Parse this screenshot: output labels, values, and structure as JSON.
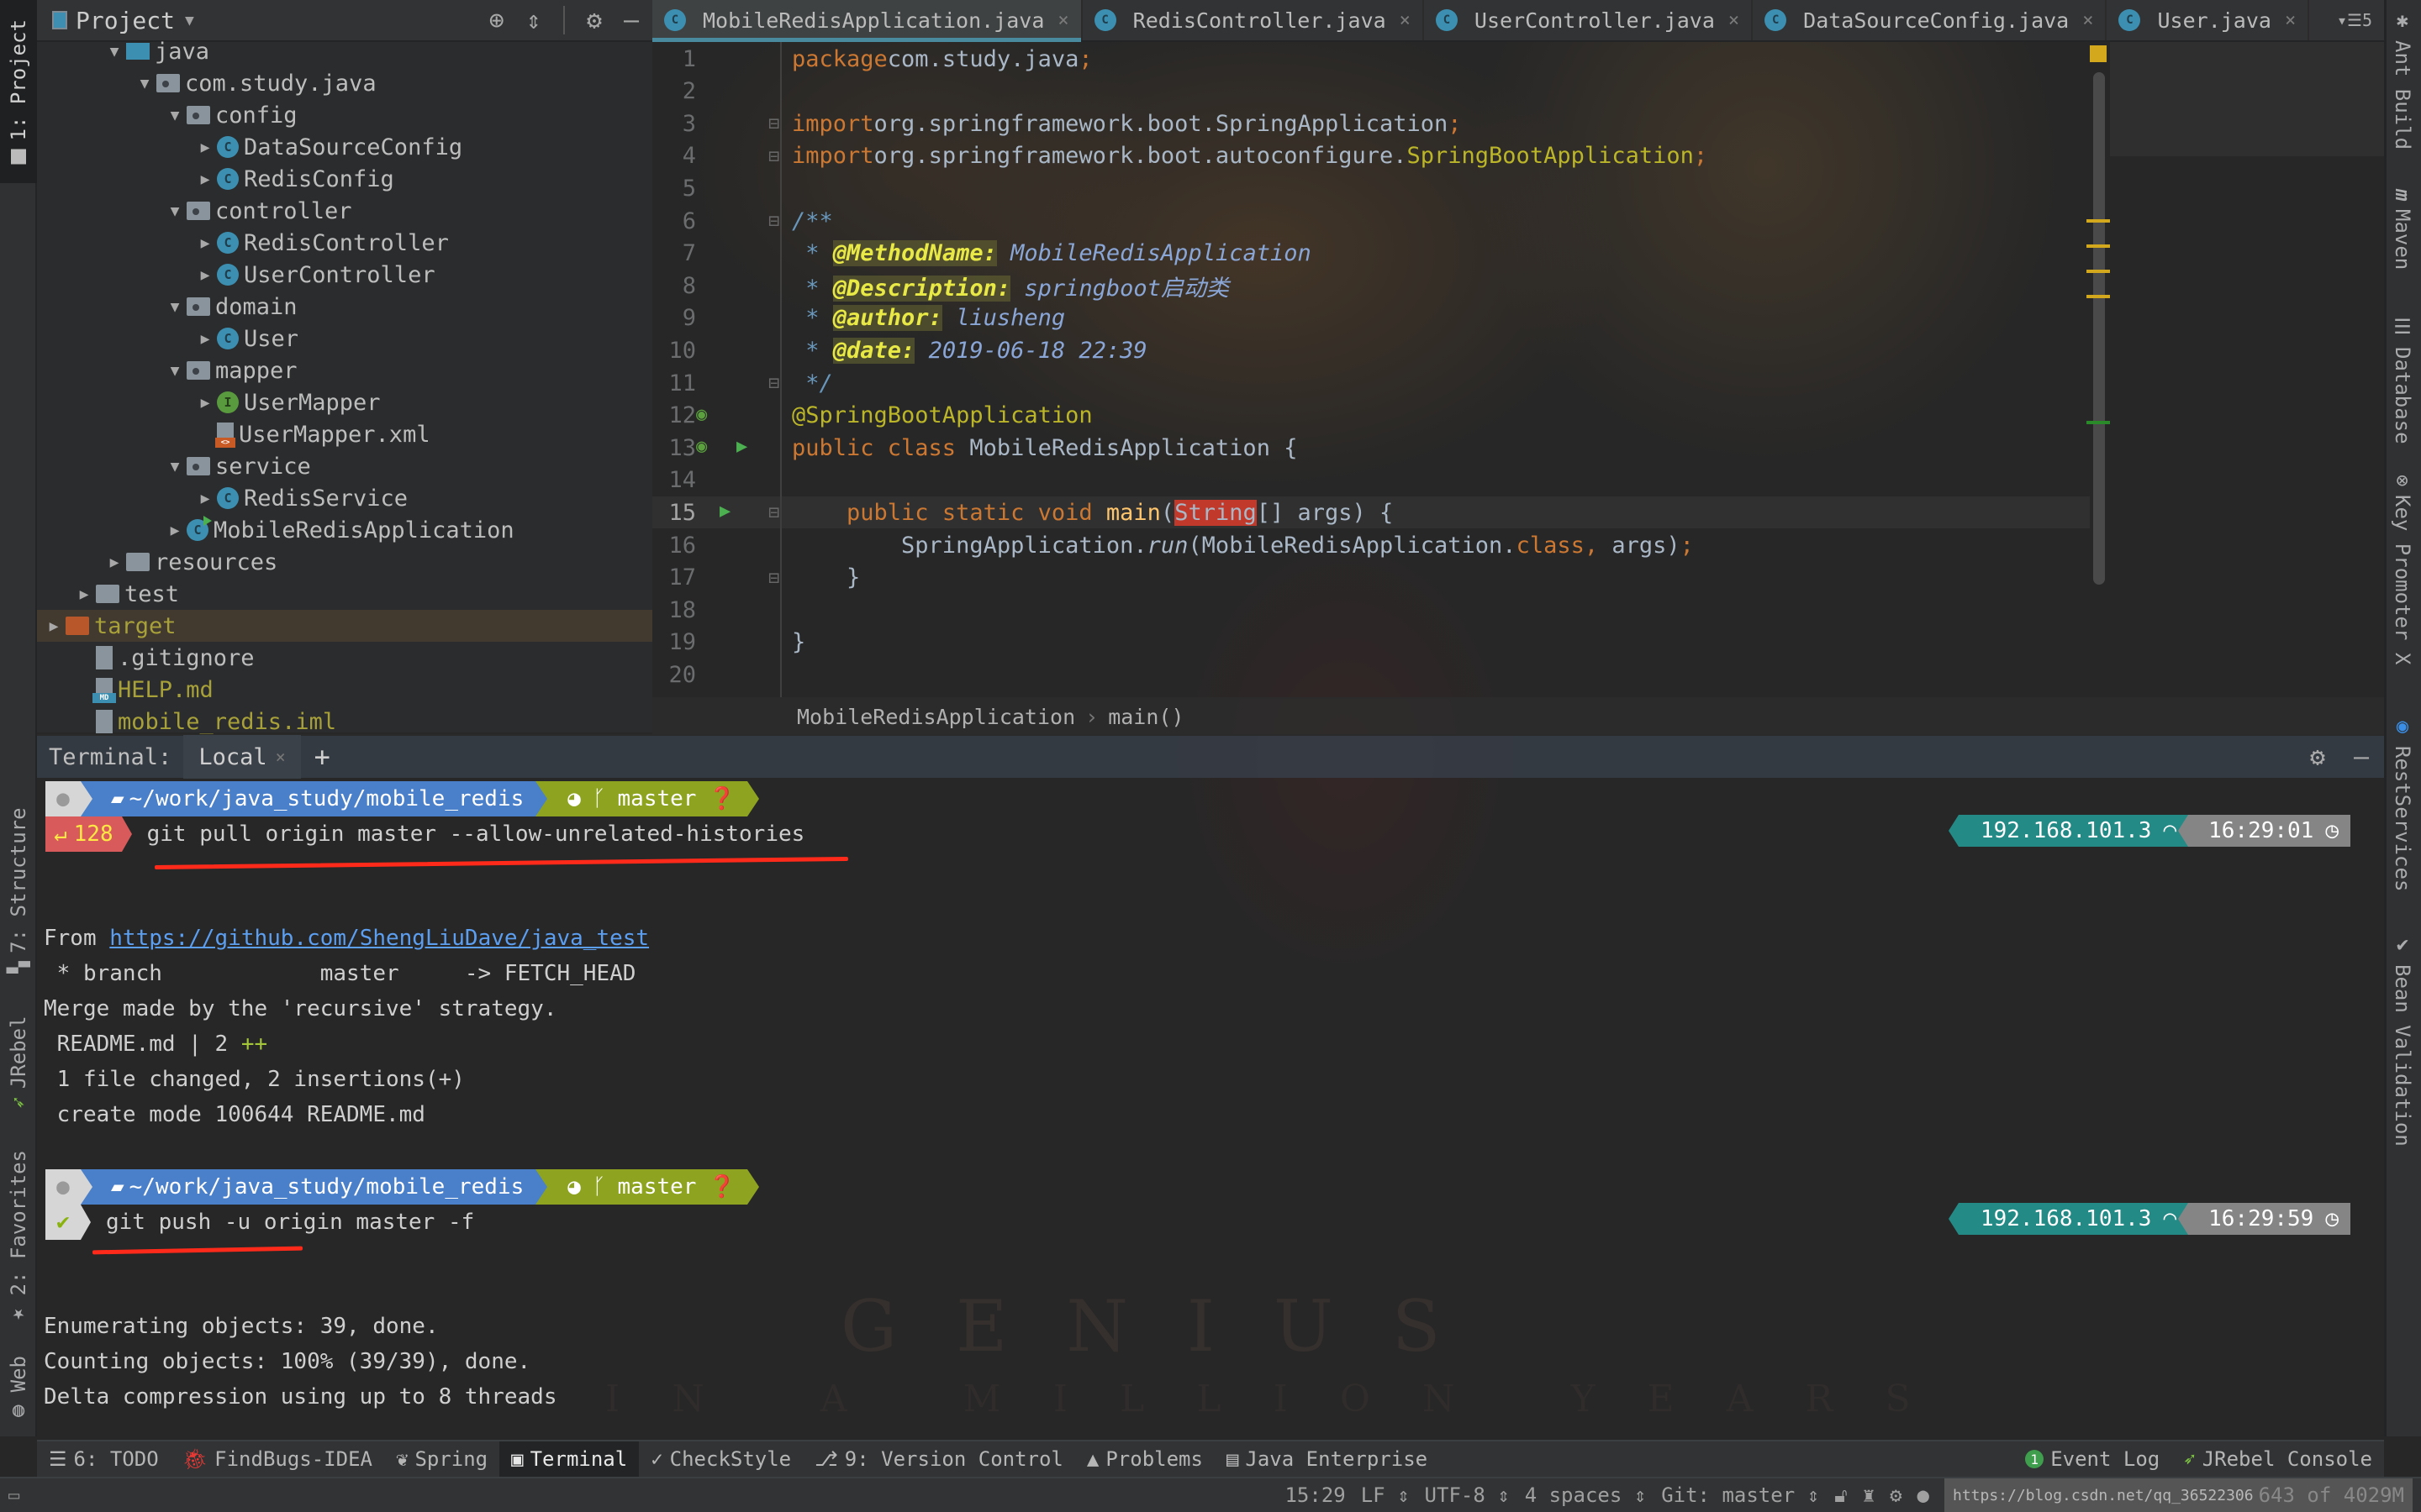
{
  "project_panel": {
    "title": "Project",
    "tools": [
      "locate-icon",
      "collapse-all-icon",
      "gear-icon",
      "minimize-icon"
    ],
    "tree": [
      {
        "label": "java",
        "icon": "source-folder",
        "indent": 3,
        "arrow": "expanded"
      },
      {
        "label": "com.study.java",
        "icon": "package",
        "indent": 4,
        "arrow": "expanded"
      },
      {
        "label": "config",
        "icon": "package",
        "indent": 5,
        "arrow": "expanded"
      },
      {
        "label": "DataSourceConfig",
        "icon": "class",
        "indent": 6,
        "arrow": "collapsed"
      },
      {
        "label": "RedisConfig",
        "icon": "class",
        "indent": 6,
        "arrow": "collapsed"
      },
      {
        "label": "controller",
        "icon": "package",
        "indent": 5,
        "arrow": "expanded"
      },
      {
        "label": "RedisController",
        "icon": "class",
        "indent": 6,
        "arrow": "collapsed"
      },
      {
        "label": "UserController",
        "icon": "class",
        "indent": 6,
        "arrow": "collapsed"
      },
      {
        "label": "domain",
        "icon": "package",
        "indent": 5,
        "arrow": "expanded"
      },
      {
        "label": "User",
        "icon": "class",
        "indent": 6,
        "arrow": "collapsed"
      },
      {
        "label": "mapper",
        "icon": "package",
        "indent": 5,
        "arrow": "expanded"
      },
      {
        "label": "UserMapper",
        "icon": "interface",
        "indent": 6,
        "arrow": "collapsed"
      },
      {
        "label": "UserMapper.xml",
        "icon": "xml",
        "indent": 6,
        "arrow": "none"
      },
      {
        "label": "service",
        "icon": "package",
        "indent": 5,
        "arrow": "expanded"
      },
      {
        "label": "RedisService",
        "icon": "class",
        "indent": 6,
        "arrow": "collapsed"
      },
      {
        "label": "MobileRedisApplication",
        "icon": "spring-app",
        "indent": 5,
        "arrow": "collapsed"
      },
      {
        "label": "resources",
        "icon": "resources-folder",
        "indent": 3,
        "arrow": "collapsed"
      },
      {
        "label": "test",
        "icon": "folder",
        "indent": 2,
        "arrow": "collapsed"
      },
      {
        "label": "target",
        "icon": "excluded-folder",
        "indent": 1,
        "arrow": "collapsed",
        "highlight": true,
        "color": "olive"
      },
      {
        "label": ".gitignore",
        "icon": "text-file",
        "indent": 2,
        "arrow": "none"
      },
      {
        "label": "HELP.md",
        "icon": "markdown-file",
        "indent": 2,
        "arrow": "none",
        "color": "olive"
      },
      {
        "label": "mobile_redis.iml",
        "icon": "iml-file",
        "indent": 2,
        "arrow": "none",
        "color": "olive"
      }
    ]
  },
  "left_stripe": {
    "top": [
      {
        "label": "1: Project",
        "active": true
      }
    ],
    "bottom": [
      {
        "label": "7: Structure"
      },
      {
        "label": "JRebel"
      },
      {
        "label": "2: Favorites"
      },
      {
        "label": "Web"
      }
    ]
  },
  "right_stripe": [
    {
      "label": "Ant Build",
      "icon": "ant-icon"
    },
    {
      "label": "Maven",
      "icon": "maven-icon"
    },
    {
      "label": "Database",
      "icon": "database-icon"
    },
    {
      "label": "Key Promoter X",
      "icon": "key-promoter-icon"
    },
    {
      "label": "RestServices",
      "icon": "rest-services-icon"
    },
    {
      "label": "Bean Validation",
      "icon": "bean-validation-icon"
    }
  ],
  "editor_tabs": [
    {
      "label": "MobileRedisApplication.java",
      "active": true,
      "icon": "spring-app"
    },
    {
      "label": "RedisController.java",
      "active": false,
      "icon": "class"
    },
    {
      "label": "UserController.java",
      "active": false,
      "icon": "class"
    },
    {
      "label": "DataSourceConfig.java",
      "active": false,
      "icon": "class"
    },
    {
      "label": "User.java",
      "active": false,
      "icon": "class"
    }
  ],
  "tab_overflow_count": "5",
  "editor": {
    "current_line": 15,
    "lines": [
      {
        "n": "1",
        "tokens": [
          [
            "kw",
            "package"
          ],
          [
            "",
            "com.study.java"
          ],
          [
            "kw",
            ";"
          ]
        ]
      },
      {
        "n": "2",
        "tokens": []
      },
      {
        "n": "3",
        "tokens": [
          [
            "kw",
            "import"
          ],
          [
            "",
            "org.springframework.boot.SpringApplication"
          ],
          [
            "kw",
            ";"
          ]
        ]
      },
      {
        "n": "4",
        "tokens": [
          [
            "kw",
            "import"
          ],
          [
            "",
            "org.springframework.boot.autoconfigure."
          ],
          [
            "ann",
            "SpringBootApplication"
          ],
          [
            "kw",
            ";"
          ]
        ]
      },
      {
        "n": "5",
        "tokens": []
      },
      {
        "n": "6",
        "tokens": [
          [
            "doc-star",
            "/**"
          ]
        ]
      },
      {
        "n": "7",
        "tokens": [
          [
            "doc-star",
            " * "
          ],
          [
            "doctag",
            "@MethodName:"
          ],
          [
            "docval",
            " MobileRedisApplication"
          ]
        ]
      },
      {
        "n": "8",
        "tokens": [
          [
            "doc-star",
            " * "
          ],
          [
            "doctag",
            "@Description:"
          ],
          [
            "docval",
            " springboot启动类"
          ]
        ]
      },
      {
        "n": "9",
        "tokens": [
          [
            "doc-star",
            " * "
          ],
          [
            "doctag",
            "@author:"
          ],
          [
            "docval",
            " liusheng"
          ]
        ]
      },
      {
        "n": "10",
        "tokens": [
          [
            "doc-star",
            " * "
          ],
          [
            "doctag",
            "@date:"
          ],
          [
            "docval",
            " 2019-06-18 22:39"
          ]
        ]
      },
      {
        "n": "11",
        "tokens": [
          [
            "doc-star",
            " */"
          ]
        ]
      },
      {
        "n": "12",
        "tokens": [
          [
            "ann",
            "@SpringBootApplication"
          ]
        ]
      },
      {
        "n": "13",
        "tokens": [
          [
            "kw",
            "public class "
          ],
          [
            "",
            "MobileRedisApplication {"
          ]
        ]
      },
      {
        "n": "14",
        "tokens": []
      },
      {
        "n": "15",
        "tokens": [
          [
            "",
            "    "
          ],
          [
            "kw",
            "public static void "
          ],
          [
            "method",
            "main"
          ],
          [
            "",
            "("
          ],
          [
            "str-err",
            "String"
          ],
          [
            "",
            "[] args) {"
          ]
        ]
      },
      {
        "n": "16",
        "tokens": [
          [
            "",
            "        SpringApplication."
          ],
          [
            "italic",
            "run"
          ],
          [
            "",
            "(MobileRedisApplication."
          ],
          [
            "kw",
            "class, "
          ],
          [
            "",
            "args)"
          ],
          [
            "kw",
            ";"
          ]
        ]
      },
      {
        "n": "17",
        "tokens": [
          [
            "",
            "    }"
          ]
        ]
      },
      {
        "n": "18",
        "tokens": []
      },
      {
        "n": "19",
        "tokens": [
          [
            "",
            "}"
          ]
        ]
      },
      {
        "n": "20",
        "tokens": []
      }
    ]
  },
  "breadcrumb": [
    "MobileRedisApplication",
    "main()"
  ],
  "terminal": {
    "label": "Terminal:",
    "tab": "Local",
    "prompt": {
      "path": "~/work/java_study/mobile_redis",
      "branch": "master",
      "ip": "192.168.101.3"
    },
    "session1": {
      "exit_code": "128",
      "command": "git pull origin master --allow-unrelated-histories",
      "time": "16:29:01",
      "output": [
        {
          "prefix": "From ",
          "link": "https://github.com/ShengLiuDave/java_test"
        },
        {
          "text": " * branch            master     -> FETCH_HEAD"
        },
        {
          "text": "Merge made by the 'recursive' strategy."
        },
        {
          "text": " README.md | 2 ",
          "suffix": "++"
        },
        {
          "text": " 1 file changed, 2 insertions(+)"
        },
        {
          "text": " create mode 100644 README.md"
        }
      ]
    },
    "session2": {
      "status": "ok",
      "command": "git push -u origin master -f",
      "time": "16:29:59",
      "output": [
        "Enumerating objects: 39, done.",
        "Counting objects: 100% (39/39), done.",
        "Delta compression using up to 8 threads"
      ]
    }
  },
  "tool_windows": [
    {
      "label": "6: TODO",
      "icon": "todo-icon"
    },
    {
      "label": "FindBugs-IDEA",
      "icon": "findbugs-icon"
    },
    {
      "label": "Spring",
      "icon": "spring-icon"
    },
    {
      "label": "Terminal",
      "icon": "terminal-icon",
      "active": true
    },
    {
      "label": "CheckStyle",
      "icon": "checkstyle-icon"
    },
    {
      "label": "9: Version Control",
      "icon": "vcs-icon"
    },
    {
      "label": "Problems",
      "icon": "warning-icon"
    },
    {
      "label": "Java Enterprise",
      "icon": "java-ee-icon"
    }
  ],
  "tool_windows_right": [
    {
      "label": "Event Log",
      "icon": "event-log-icon",
      "badge": "1"
    },
    {
      "label": "JRebel Console",
      "icon": "jrebel-icon"
    }
  ],
  "status_bar": {
    "position": "15:29",
    "line_sep": "LF",
    "encoding": "UTF-8",
    "indent": "4 spaces",
    "vcs": "Git: master",
    "memory": "643 of 4029M",
    "url_overlay": "https://blog.csdn.net/qq_36522306"
  },
  "background_text": {
    "main": "GENIUS",
    "sub": "IN A MILLION YEARS"
  },
  "colors": {
    "keyword": "#cc7832",
    "annotation": "#bbb529",
    "prompt_path": "#4a7fc9",
    "prompt_git": "#8ea420",
    "prompt_error": "#d85a5a",
    "ip_segment": "#248a86",
    "time_segment": "#858585",
    "underline": "#ff2a1a"
  }
}
